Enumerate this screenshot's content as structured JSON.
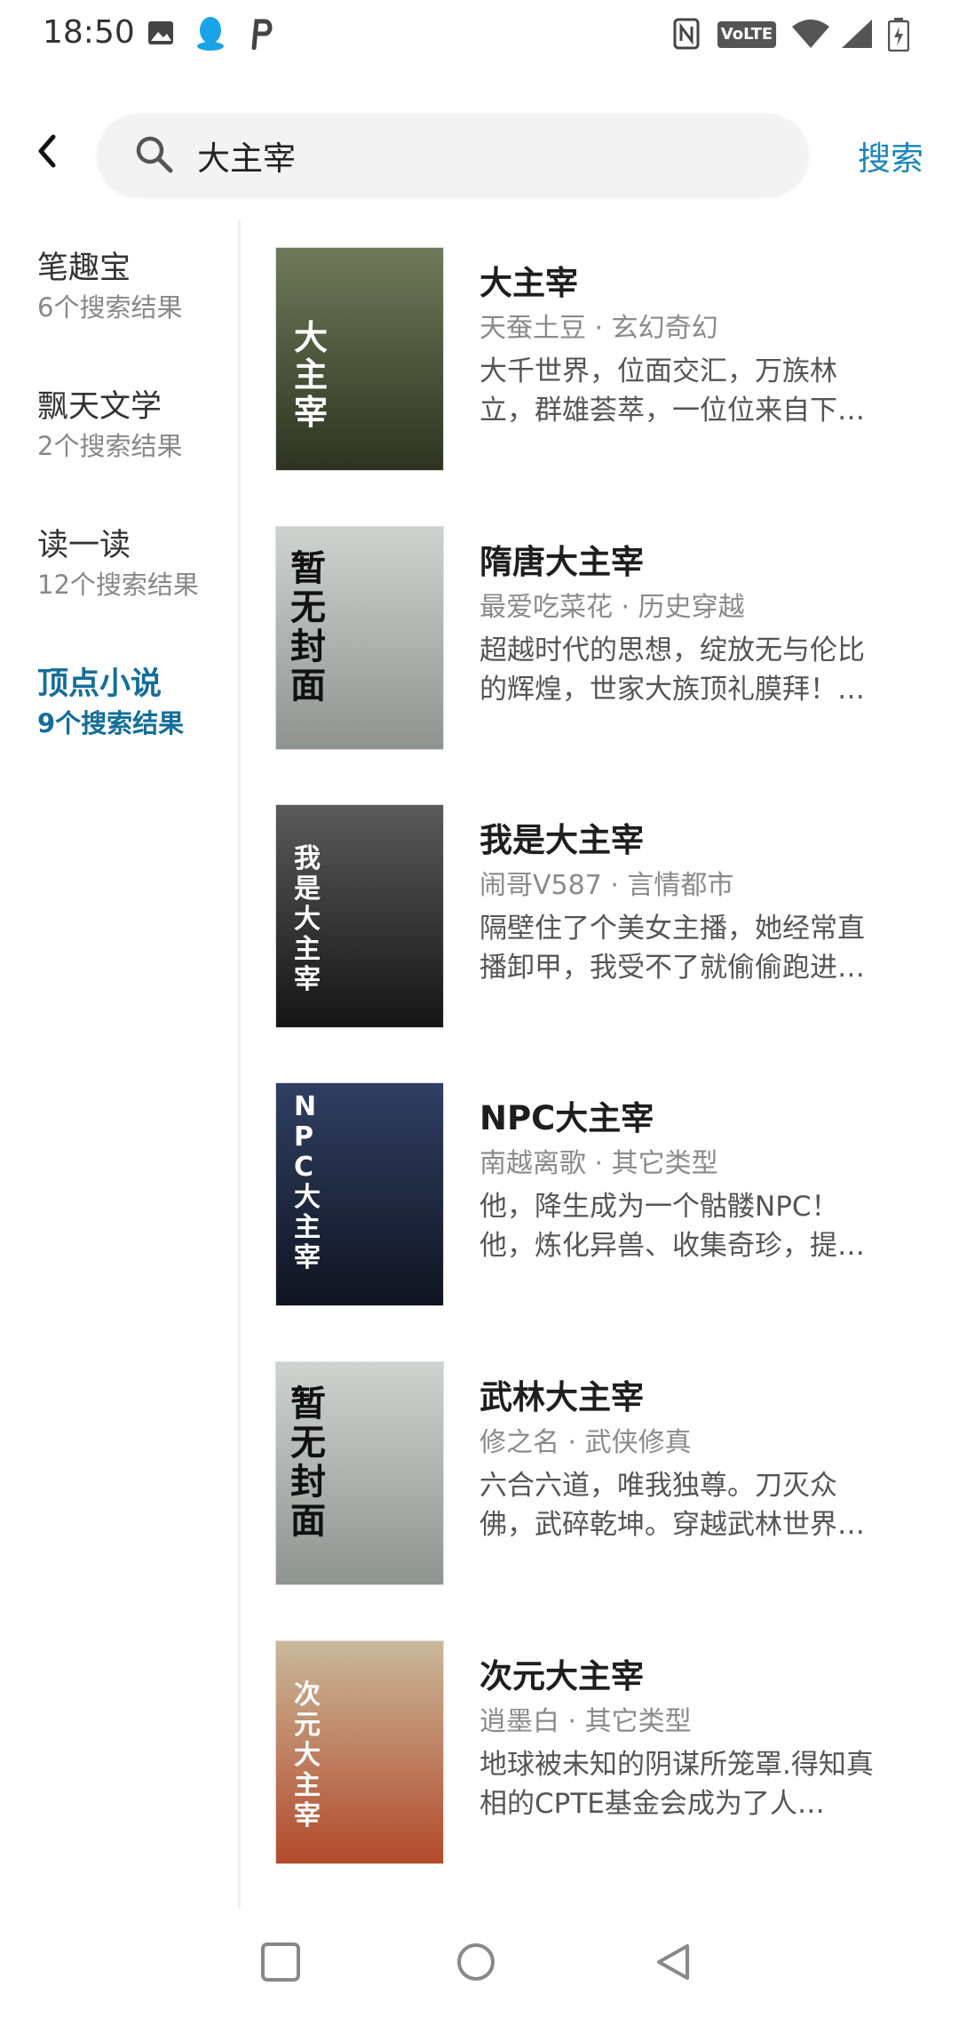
{
  "status_bar": {
    "time": "18:50",
    "left_icons": [
      "image-icon",
      "qq-icon",
      "parking-p-icon"
    ],
    "right_icons": [
      "nfc-icon",
      "volte-icon",
      "wifi-icon",
      "signal-icon",
      "battery-icon"
    ],
    "volte_label": "VoLTE"
  },
  "header": {
    "search_value": "大主宰",
    "search_button": "搜索"
  },
  "sources": [
    {
      "name": "笔趣宝",
      "count": "6个搜索结果",
      "active": false
    },
    {
      "name": "飘天文学",
      "count": "2个搜索结果",
      "active": false
    },
    {
      "name": "读一读",
      "count": "12个搜索结果",
      "active": false
    },
    {
      "name": "顶点小说",
      "count": "9个搜索结果",
      "active": true
    }
  ],
  "books": [
    {
      "title": "大主宰",
      "meta": "天蚕土豆 · 玄幻奇幻",
      "desc": "大千世界，位面交汇，万族林立，群雄荟萃，一位位来自下…",
      "cover": "大主宰",
      "cover_colors": [
        "#6f7a5a",
        "#2d3320"
      ]
    },
    {
      "title": "隋唐大主宰",
      "meta": "最爱吃菜花 · 历史穿越",
      "desc": "超越时代的思想，绽放无与伦比的辉煌，世家大族顶礼膜拜！…",
      "cover": "暂无封面",
      "cover_colors": [
        "#cfd3cf",
        "#8e9490"
      ]
    },
    {
      "title": "我是大主宰",
      "meta": "闹哥V587 · 言情都市",
      "desc": "隔壁住了个美女主播，她经常直播卸甲，我受不了就偷偷跑进…",
      "cover": "我是大主宰",
      "cover_colors": [
        "#5a5a5a",
        "#151515"
      ]
    },
    {
      "title": "NPC大主宰",
      "meta": "南越离歌 · 其它类型",
      "desc": "他，降生成为一个骷髅NPC！他，炼化异兽、收集奇珍，提…",
      "cover": "NPC大主宰",
      "cover_colors": [
        "#2f3f63",
        "#101420"
      ]
    },
    {
      "title": "武林大主宰",
      "meta": "修之名 · 武侠修真",
      "desc": "六合六道，唯我独尊。刀灭众佛，武碎乾坤。穿越武林世界…",
      "cover": "暂无封面",
      "cover_colors": [
        "#cfd3cf",
        "#8e9490"
      ]
    },
    {
      "title": "次元大主宰",
      "meta": "逍墨白 · 其它类型",
      "desc": "地球被未知的阴谋所笼罩.得知真相的CPTE基金会成为了人…",
      "cover": "次元大主宰",
      "cover_colors": [
        "#c9b89a",
        "#b34a2a"
      ]
    }
  ],
  "nav_bar": {
    "icons": [
      "recents-square-icon",
      "home-circle-icon",
      "back-triangle-icon"
    ]
  }
}
